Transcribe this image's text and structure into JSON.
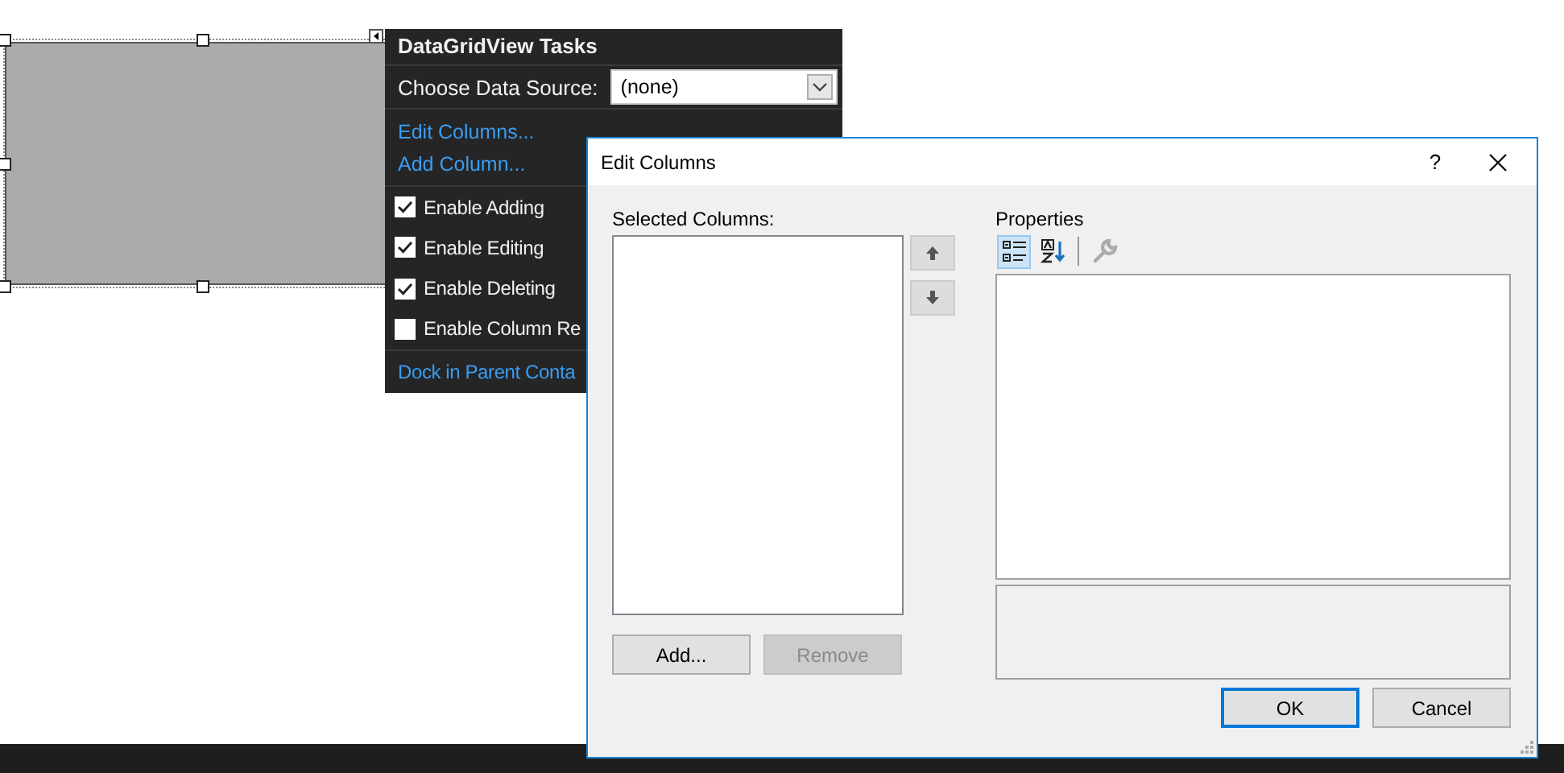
{
  "task_panel": {
    "title": "DataGridView Tasks",
    "data_source": {
      "label": "Choose Data Source:",
      "value": "(none)"
    },
    "links": [
      "Edit Columns...",
      "Add Column..."
    ],
    "options": [
      {
        "label": "Enable Adding",
        "checked": true
      },
      {
        "label": "Enable Editing",
        "checked": true
      },
      {
        "label": "Enable Deleting",
        "checked": true
      },
      {
        "label": "Enable Column Re",
        "checked": false
      }
    ],
    "footer_link": "Dock in Parent Conta"
  },
  "dialog": {
    "title": "Edit Columns",
    "help": "?",
    "selected_columns": {
      "label": "Selected Columns:"
    },
    "move_buttons": [
      {
        "kind": "up"
      },
      {
        "kind": "down"
      }
    ],
    "properties": {
      "label": "Properties",
      "toolbar": [
        {
          "kind": "categorized",
          "selected": true,
          "disabled": false
        },
        {
          "kind": "alphabetical",
          "selected": false,
          "disabled": false
        },
        {
          "kind": "property-pages",
          "selected": false,
          "disabled": true
        }
      ]
    },
    "list_buttons": [
      {
        "label": "Add...",
        "disabled": false
      },
      {
        "label": "Remove",
        "disabled": true
      }
    ],
    "buttons": [
      {
        "label": "OK",
        "default": true
      },
      {
        "label": "Cancel",
        "default": false
      }
    ]
  }
}
